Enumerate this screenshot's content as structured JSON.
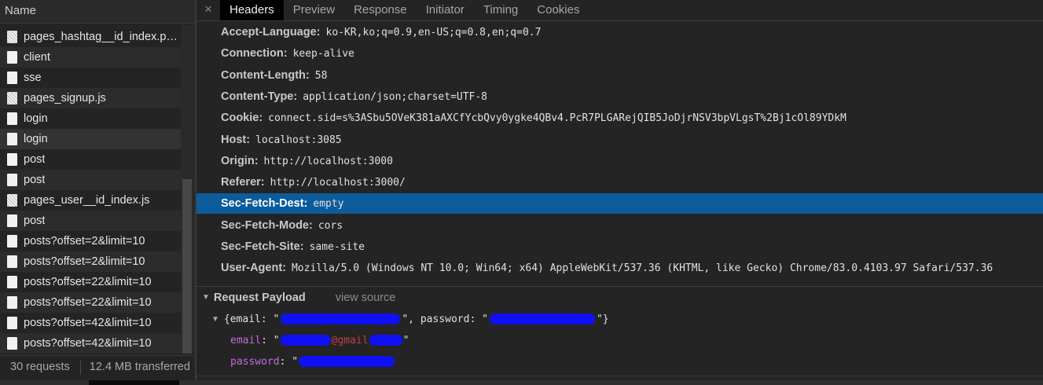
{
  "requests_panel": {
    "column_header": "Name",
    "items": [
      {
        "name": "pages_hashtag__id_index.pag...",
        "icon": "image-file-icon"
      },
      {
        "name": "client",
        "icon": "document-icon"
      },
      {
        "name": "sse",
        "icon": "document-icon"
      },
      {
        "name": "pages_signup.js",
        "icon": "image-file-icon"
      },
      {
        "name": "login",
        "icon": "document-icon"
      },
      {
        "name": "login",
        "icon": "document-icon"
      },
      {
        "name": "post",
        "icon": "document-icon"
      },
      {
        "name": "post",
        "icon": "document-icon"
      },
      {
        "name": "pages_user__id_index.js",
        "icon": "image-file-icon"
      },
      {
        "name": "post",
        "icon": "document-icon"
      },
      {
        "name": "posts?offset=2&limit=10",
        "icon": "document-icon"
      },
      {
        "name": "posts?offset=2&limit=10",
        "icon": "document-icon"
      },
      {
        "name": "posts?offset=22&limit=10",
        "icon": "document-icon"
      },
      {
        "name": "posts?offset=22&limit=10",
        "icon": "document-icon"
      },
      {
        "name": "posts?offset=42&limit=10",
        "icon": "document-icon"
      },
      {
        "name": "posts?offset=42&limit=10",
        "icon": "document-icon"
      }
    ],
    "footer": {
      "requests": "30 requests",
      "transferred": "12.4 MB transferred"
    }
  },
  "detail_panel": {
    "close_symbol": "×",
    "tabs": [
      "Headers",
      "Preview",
      "Response",
      "Initiator",
      "Timing",
      "Cookies"
    ],
    "active_tab": "Headers",
    "request_headers": [
      {
        "key": "Accept-Language:",
        "value": "ko-KR,ko;q=0.9,en-US;q=0.8,en;q=0.7"
      },
      {
        "key": "Connection:",
        "value": "keep-alive"
      },
      {
        "key": "Content-Length:",
        "value": "58"
      },
      {
        "key": "Content-Type:",
        "value": "application/json;charset=UTF-8"
      },
      {
        "key": "Cookie:",
        "value": "connect.sid=s%3ASbu5OVeK381aAXCfYcbQvy0ygke4QBv4.PcR7PLGARejQIB5JoDjrNSV3bpVLgsT%2Bj1cOl89YDkM"
      },
      {
        "key": "Host:",
        "value": "localhost:3085"
      },
      {
        "key": "Origin:",
        "value": "http://localhost:3000"
      },
      {
        "key": "Referer:",
        "value": "http://localhost:3000/"
      },
      {
        "key": "Sec-Fetch-Dest:",
        "value": "empty"
      },
      {
        "key": "Sec-Fetch-Mode:",
        "value": "cors"
      },
      {
        "key": "Sec-Fetch-Site:",
        "value": "same-site"
      },
      {
        "key": "User-Agent:",
        "value": "Mozilla/5.0 (Windows NT 10.0; Win64; x64) AppleWebKit/537.36 (KHTML, like Gecko) Chrome/83.0.4103.97 Safari/537.36"
      }
    ],
    "payload": {
      "title": "Request Payload",
      "view_source": "view source",
      "summary_open": "{email: \"",
      "summary_mid": "\", password: \"",
      "summary_close": "\"}",
      "email_key": "email",
      "password_key": "password",
      "email_visible_fragment": "@gmail",
      "colon": ": ",
      "quote": "\""
    },
    "colors": {
      "selected_row": "#0c5c9b",
      "redaction": "#1010f5",
      "payload_key": "#c26bd6"
    }
  }
}
